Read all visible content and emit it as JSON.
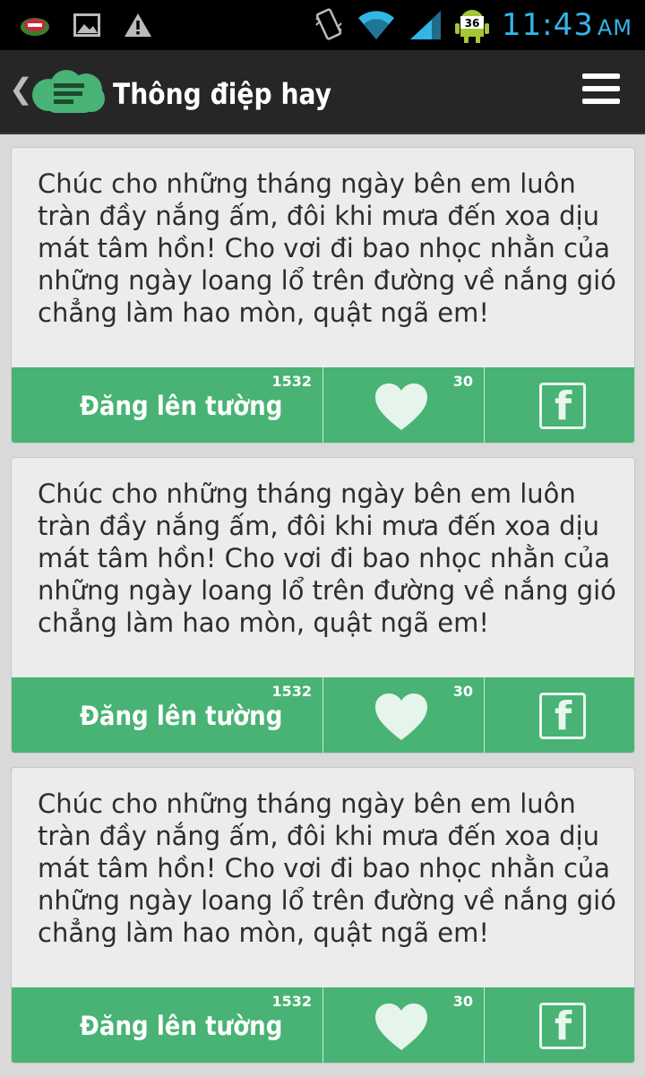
{
  "statusbar": {
    "time": "11:43",
    "ampm": "AM",
    "battery_level": "36",
    "icons": [
      "app-notification-icon",
      "image-icon",
      "warning-icon",
      "vibrate-icon",
      "wifi-icon",
      "signal-icon",
      "battery-android-icon"
    ]
  },
  "appbar": {
    "back_icon": "chevron-left-icon",
    "logo_icon": "cloud-message-icon",
    "title": "Thông điệp hay",
    "menu_icon": "hamburger-menu-icon"
  },
  "colors": {
    "accent_green": "#48b374",
    "appbar_bg": "#262626",
    "statusbar_text": "#33b5e5",
    "card_bg": "#ececec",
    "page_bg": "#d9d9d9"
  },
  "cards": [
    {
      "text": "Chúc cho những tháng ngày bên em luôn tràn đầy nắng ấm, đôi khi mưa đến xoa dịu mát tâm hồn! Cho vơi đi bao nhọc nhằn của những ngày loang lổ trên đường về nắng gió chẳng làm hao mòn, quật ngã em!",
      "post_label": "Đăng lên tường",
      "post_count": "1532",
      "like_count": "30",
      "like_icon": "heart-icon",
      "share_icon": "facebook-icon"
    },
    {
      "text": "Chúc cho những tháng ngày bên em luôn tràn đầy nắng ấm, đôi khi mưa đến xoa dịu mát tâm hồn! Cho vơi đi bao nhọc nhằn của những ngày loang lổ trên đường về nắng gió chẳng làm hao mòn, quật ngã em!",
      "post_label": "Đăng lên tường",
      "post_count": "1532",
      "like_count": "30",
      "like_icon": "heart-icon",
      "share_icon": "facebook-icon"
    },
    {
      "text": "Chúc cho những tháng ngày bên em luôn tràn đầy nắng ấm, đôi khi mưa đến xoa dịu mát tâm hồn! Cho vơi đi bao nhọc nhằn của những ngày loang lổ trên đường về nắng gió chẳng làm hao mòn, quật ngã em!",
      "post_label": "Đăng lên tường",
      "post_count": "1532",
      "like_count": "30",
      "like_icon": "heart-icon",
      "share_icon": "facebook-icon"
    }
  ]
}
